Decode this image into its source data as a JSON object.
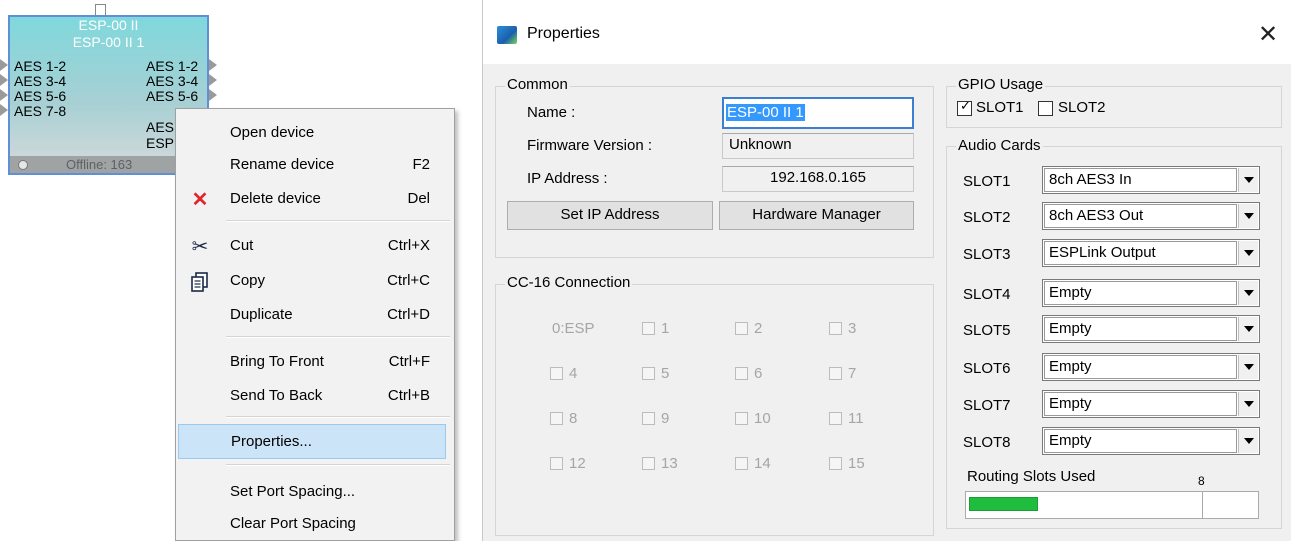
{
  "device": {
    "model": "ESP-00 II",
    "name": "ESP-00 II 1",
    "inputs": [
      "AES 1-2",
      "AES 3-4",
      "AES 5-6",
      "AES 7-8"
    ],
    "outputs": [
      "AES 1-2",
      "AES 3-4",
      "AES 5-6",
      "AES",
      "ESP"
    ],
    "status": "Offline: 163"
  },
  "context_menu": {
    "items": [
      {
        "label": "Open device",
        "shortcut": "",
        "icon": ""
      },
      {
        "label": "Rename device",
        "shortcut": "F2",
        "icon": ""
      },
      {
        "label": "Delete device",
        "shortcut": "Del",
        "icon": "delete-x-icon"
      },
      {
        "label": "Cut",
        "shortcut": "Ctrl+X",
        "icon": "scissors-icon"
      },
      {
        "label": "Copy",
        "shortcut": "Ctrl+C",
        "icon": "copy-icon"
      },
      {
        "label": "Duplicate",
        "shortcut": "Ctrl+D",
        "icon": ""
      },
      {
        "label": "Bring To Front",
        "shortcut": "Ctrl+F",
        "icon": ""
      },
      {
        "label": "Send To Back",
        "shortcut": "Ctrl+B",
        "icon": ""
      },
      {
        "label": "Properties...",
        "shortcut": "",
        "icon": "",
        "highlighted": true
      },
      {
        "label": "Set Port Spacing...",
        "shortcut": "",
        "icon": ""
      },
      {
        "label": "Clear Port Spacing",
        "shortcut": "",
        "icon": ""
      }
    ]
  },
  "dialog": {
    "title": "Properties",
    "close_glyph": "✕",
    "common": {
      "legend": "Common",
      "name_label": "Name :",
      "name_value": "ESP-00 II 1",
      "firmware_label": "Firmware Version :",
      "firmware_value": "Unknown",
      "ip_label": "IP Address :",
      "ip_value": "192.168.0.165",
      "set_ip_button": "Set IP Address",
      "hardware_manager_button": "Hardware Manager"
    },
    "cc16": {
      "legend": "CC-16 Connection",
      "first_label": "0:ESP",
      "checkboxes": [
        "1",
        "2",
        "3",
        "4",
        "5",
        "6",
        "7",
        "8",
        "9",
        "10",
        "11",
        "12",
        "13",
        "14",
        "15"
      ]
    },
    "gpio": {
      "legend": "GPIO Usage",
      "slot1_label": "SLOT1",
      "slot1_checked": true,
      "slot2_label": "SLOT2",
      "slot2_checked": false
    },
    "audio_cards": {
      "legend": "Audio Cards",
      "slots": [
        {
          "label": "SLOT1",
          "value": "8ch AES3 In"
        },
        {
          "label": "SLOT2",
          "value": "8ch AES3 Out"
        },
        {
          "label": "SLOT3",
          "value": "ESPLink Output"
        },
        {
          "label": "SLOT4",
          "value": "Empty"
        },
        {
          "label": "SLOT5",
          "value": "Empty"
        },
        {
          "label": "SLOT6",
          "value": "Empty"
        },
        {
          "label": "SLOT7",
          "value": "Empty"
        },
        {
          "label": "SLOT8",
          "value": "Empty"
        }
      ],
      "routing_label": "Routing Slots Used",
      "routing_value": "8",
      "routing_fraction": 0.3
    }
  },
  "colors": {
    "highlight": "#cce4f7",
    "progress_fill": "#1fbd3e",
    "selection": "#3399ff",
    "delete_icon": "#e0252b"
  }
}
